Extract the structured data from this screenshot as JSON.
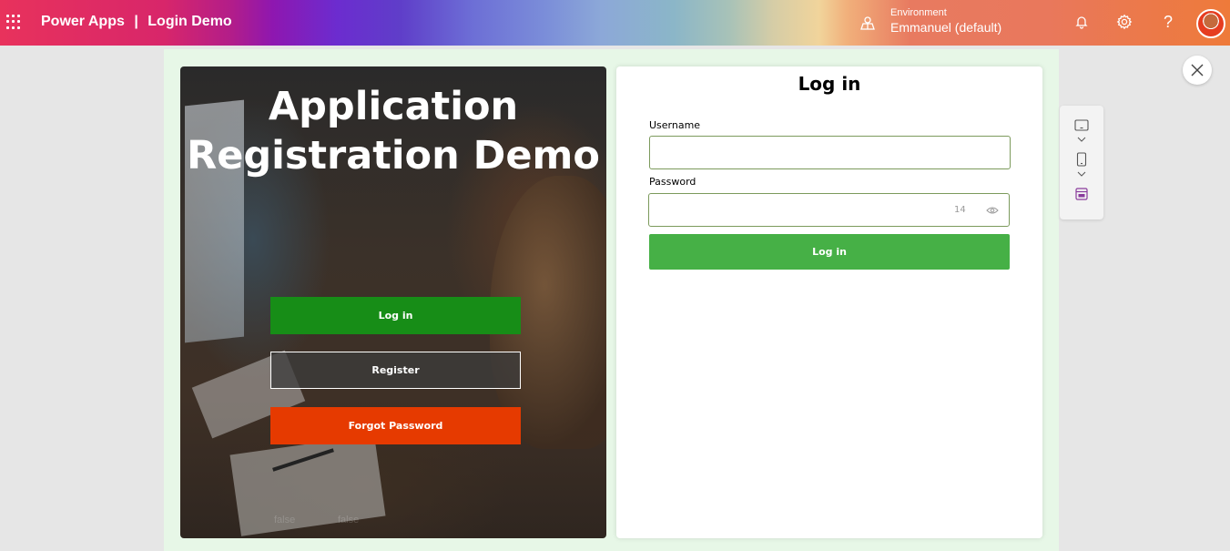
{
  "header": {
    "app_name": "Power Apps",
    "separator": "|",
    "app_title": "Login Demo",
    "environment_label": "Environment",
    "environment_value": "Emmanuel (default)",
    "help_label": "?"
  },
  "left_panel": {
    "heading_line1": "Application",
    "heading_line2": "Registration Demo",
    "login_label": "Log in",
    "register_label": "Register",
    "forgot_label": "Forgot Password",
    "faint_text_1": "false",
    "faint_text_2": "false"
  },
  "right_panel": {
    "title": "Log in",
    "username_label": "Username",
    "username_value": "",
    "password_label": "Password",
    "password_value": "",
    "password_counter": "14",
    "submit_label": "Log in"
  },
  "colors": {
    "login_green": "#178d17",
    "forgot_orange": "#e63a00",
    "submit_green": "#46b046",
    "canvas_bg": "#e7f7e7"
  }
}
